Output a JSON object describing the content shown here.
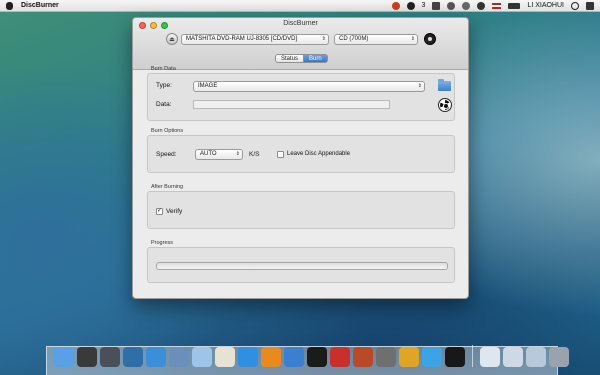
{
  "menubar": {
    "app_name": "DiscBurner",
    "badge_count": "3",
    "user": "LI XIAOHUI"
  },
  "window": {
    "title": "DiscBurner",
    "drive": "MATSHITA DVD-RAM UJ-8305 [CD/DVD]",
    "media": "CD (700M)",
    "tabs": [
      {
        "label": "Status",
        "active": false
      },
      {
        "label": "Burn",
        "active": true
      }
    ]
  },
  "burn_data": {
    "section_label": "Burn Data",
    "type_label": "Type:",
    "type_value": "IMAGE",
    "data_label": "Data:",
    "data_value": ""
  },
  "burn_options": {
    "section_label": "Burn Options",
    "speed_label": "Speed:",
    "speed_value": "AUTO",
    "speed_unit": "K/S",
    "leave_appendable_label": "Leave Disc Appendable",
    "leave_appendable_checked": false
  },
  "after_burning": {
    "section_label": "After Burning",
    "verify_label": "Verify",
    "verify_checked": true
  },
  "progress": {
    "section_label": "Progress",
    "value": 0
  },
  "dock": {
    "icons": [
      {
        "name": "finder-icon",
        "color": "#5aa0e6"
      },
      {
        "name": "launchpad-icon",
        "color": "#3a3a3a"
      },
      {
        "name": "dashboard-icon",
        "color": "#4a4f5a"
      },
      {
        "name": "mission-control-icon",
        "color": "#2f6ea8"
      },
      {
        "name": "safari-icon",
        "color": "#3b8fd8"
      },
      {
        "name": "xcode-icon",
        "color": "#6a8fb8"
      },
      {
        "name": "cube-icon",
        "color": "#9ec4e8"
      },
      {
        "name": "preview-icon",
        "color": "#e8e2d4"
      },
      {
        "name": "app-store-icon",
        "color": "#2f8fe0"
      },
      {
        "name": "ibooks-icon",
        "color": "#e98a1f"
      },
      {
        "name": "itunes-icon",
        "color": "#3a7fd0"
      },
      {
        "name": "terminal-icon",
        "color": "#1b1b1b"
      },
      {
        "name": "filezilla-icon",
        "color": "#c8302c"
      },
      {
        "name": "growl-icon",
        "color": "#b84a2a"
      },
      {
        "name": "reeder-icon",
        "color": "#6f6f6f"
      },
      {
        "name": "coin-icon",
        "color": "#e0a524"
      },
      {
        "name": "twitter-icon",
        "color": "#3ca3e6"
      },
      {
        "name": "discburner-icon",
        "color": "#181818"
      },
      {
        "name": "downloads-stack-icon",
        "color": "#dfe6ef"
      },
      {
        "name": "documents-stack-icon",
        "color": "#cfd9e6"
      },
      {
        "name": "applications-stack-icon",
        "color": "#b9c9dc"
      },
      {
        "name": "trash-icon",
        "color": "#9aa3ad"
      }
    ]
  }
}
